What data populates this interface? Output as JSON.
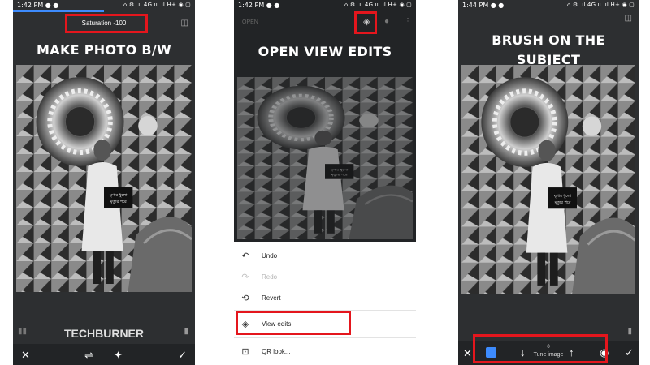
{
  "panel1": {
    "status": {
      "time": "1:42 PM ● ●",
      "icons": "⌂ ⚙ .ıl 4G ıı .ıl H+ ◉ ▢"
    },
    "saturation_label": "Saturation -100",
    "caption": "MAKE PHOTO B/W",
    "brand": "TECHBURNER",
    "toolbar": {
      "close_icon": "✕",
      "tune_icon": "⇌",
      "magic_icon": "✦",
      "apply_icon": "✓"
    }
  },
  "panel2": {
    "status": {
      "time": "1:42 PM ● ●",
      "icons": "⌂ ⚙ .ıl 4G ıı .ıl H+ ◉ ▢"
    },
    "open_label": "OPEN",
    "caption": "OPEN VIEW EDITS",
    "menu": [
      {
        "icon": "↶",
        "label": "Undo",
        "enabled": true
      },
      {
        "icon": "↷",
        "label": "Redo",
        "enabled": false
      },
      {
        "icon": "⟲",
        "label": "Revert",
        "enabled": true
      },
      {
        "icon": "◈",
        "label": "View edits",
        "enabled": true
      },
      {
        "icon": "⊡",
        "label": "QR look...",
        "enabled": true
      }
    ]
  },
  "panel3": {
    "status": {
      "time": "1:44 PM ● ●",
      "icons": "⌂ ⚙ .ıl 4G ıı .ıl H+ ◉ ▢"
    },
    "caption_line1": "BRUSH ON THE",
    "caption_line2": "SUBJECT",
    "brush": {
      "value": "0",
      "label": "Tune image"
    },
    "toolbar": {
      "close_icon": "✕",
      "down_icon": "↓",
      "up_icon": "↑",
      "eye_icon": "◉",
      "apply_icon": "✓"
    }
  },
  "colors": {
    "highlight": "#e4161d",
    "app_bg": "#2d2f31",
    "accent": "#3d8bfd"
  }
}
